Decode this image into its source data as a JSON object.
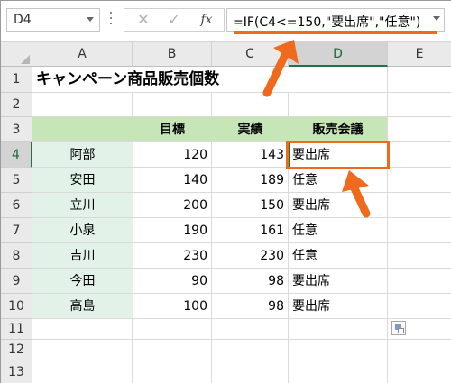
{
  "name_box": "D4",
  "formula_buttons": {
    "cancel": "✕",
    "enter": "✓",
    "fx": "fx"
  },
  "formula": "=IF(C4<=150,\"要出席\",\"任意\")",
  "columns": [
    "A",
    "B",
    "C",
    "D",
    "E"
  ],
  "rows": [
    "1",
    "2",
    "3",
    "4",
    "5",
    "6",
    "7",
    "8",
    "9",
    "10",
    "11",
    "12",
    "13"
  ],
  "title": "キャンペーン商品販売個数",
  "table": {
    "headers": {
      "target": "目標",
      "actual": "実績",
      "meeting": "販売会議"
    },
    "records": [
      {
        "name": "阿部",
        "target": "120",
        "actual": "143",
        "meeting": "要出席"
      },
      {
        "name": "安田",
        "target": "140",
        "actual": "189",
        "meeting": "任意"
      },
      {
        "name": "立川",
        "target": "200",
        "actual": "150",
        "meeting": "要出席"
      },
      {
        "name": "小泉",
        "target": "190",
        "actual": "161",
        "meeting": "任意"
      },
      {
        "name": "吉川",
        "target": "230",
        "actual": "230",
        "meeting": "任意"
      },
      {
        "name": "今田",
        "target": "90",
        "actual": "98",
        "meeting": "要出席"
      },
      {
        "name": "高島",
        "target": "100",
        "actual": "98",
        "meeting": "要出席"
      }
    ]
  },
  "colors": {
    "header_fill": "#c6e6b8",
    "name_fill": "#e2f2e9",
    "selection": "#217346",
    "annotation": "#f06a1d"
  },
  "icons": {
    "paste_options": "paste-options-icon",
    "dropdown": "chevron-down-icon"
  }
}
